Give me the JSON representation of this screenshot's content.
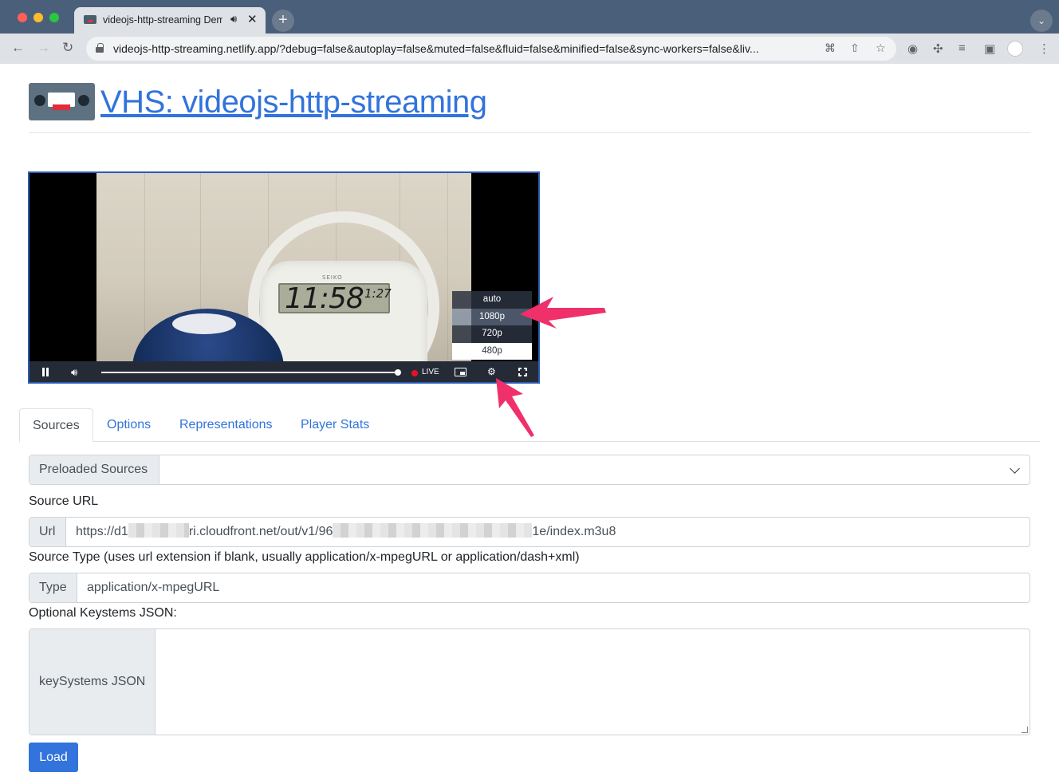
{
  "browser": {
    "tab_title": "videojs-http-streaming Demo",
    "url": "videojs-http-streaming.netlify.app/?debug=false&autoplay=false&muted=false&fluid=false&minified=false&sync-workers=false&liv..."
  },
  "header": {
    "title": "VHS: videojs-http-streaming",
    "logo_label": "VHS"
  },
  "player": {
    "clock_brand": "SEIKO",
    "clock_time": "11:58",
    "clock_small": "1:27",
    "live_label": "LIVE",
    "progress": 1.0,
    "quality_menu": {
      "items": [
        "auto",
        "1080p",
        "720p",
        "480p"
      ],
      "hovered": "1080p",
      "selected": "480p"
    }
  },
  "tabs": {
    "items": [
      "Sources",
      "Options",
      "Representations",
      "Player Stats"
    ],
    "active": "Sources"
  },
  "form": {
    "preloaded_label": "Preloaded Sources",
    "preloaded_value": "",
    "source_url_heading": "Source URL",
    "url_label": "Url",
    "url_part1": "https://d1",
    "url_part2": "ri.cloudfront.net/out/v1/96",
    "url_part3": "1e/index.m3u8",
    "source_type_heading": "Source Type (uses url extension if blank, usually application/x-mpegURL or application/dash+xml)",
    "type_label": "Type",
    "type_value": "application/x-mpegURL",
    "keysystems_heading": "Optional Keystems JSON:",
    "keysystems_label": "keySystems JSON",
    "keysystems_value": "",
    "load_button": "Load"
  },
  "colors": {
    "link": "#3273dc",
    "annotation_arrow": "#f0306a",
    "player_border": "#2a5bb5"
  }
}
